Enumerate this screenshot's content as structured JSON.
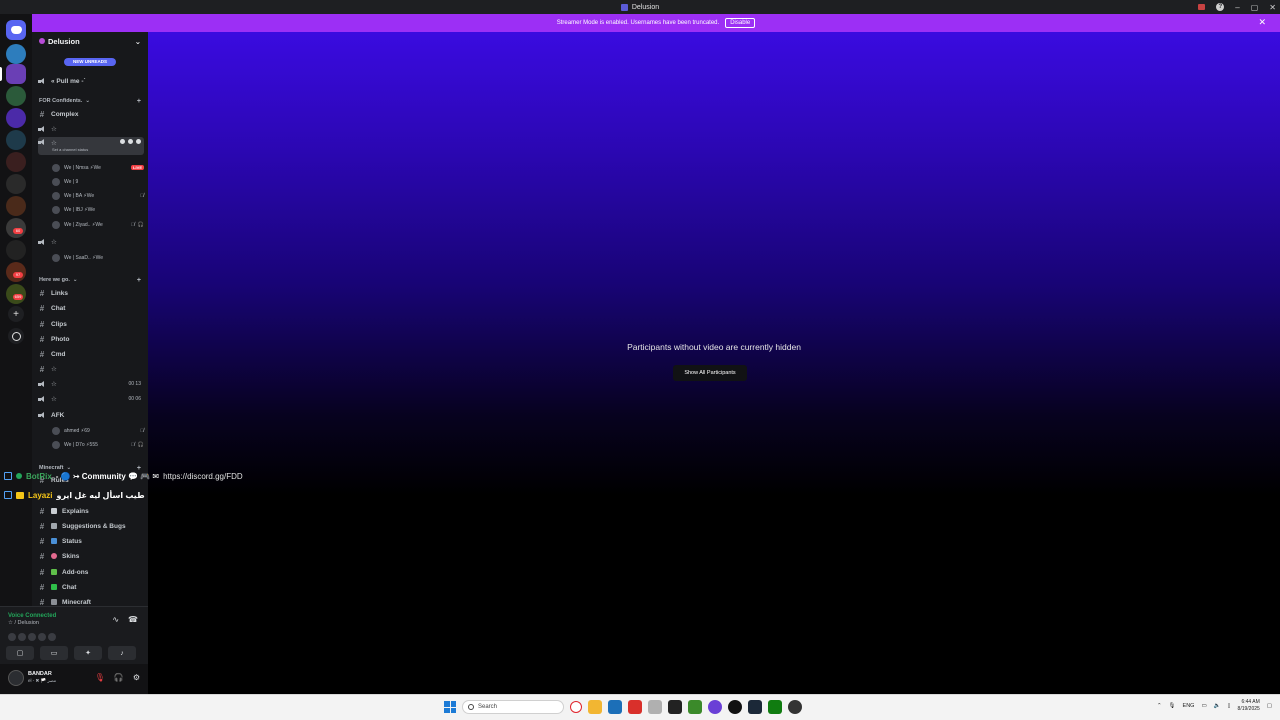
{
  "window": {
    "title": "Delusion"
  },
  "banner": {
    "text": "Streamer Mode is enabled. Usernames have been truncated.",
    "disable_label": "Disable"
  },
  "guild": {
    "name": "Delusion",
    "new_unreads": "NEW UNREADS"
  },
  "channels": {
    "pull_me": "« Pull me -ˊ",
    "cat_confidents": "FOR Confidents.",
    "complex": "Complex",
    "voice_1": "☆",
    "voice_sel": "☆",
    "set_status": "Set a channel status",
    "voice_3": "☆",
    "cat_here": "Here we go.",
    "links": "Links",
    "chat": "Chat",
    "clips": "Clips",
    "photo": "Photo",
    "cmd": "Cmd",
    "voice_4": "☆",
    "voice_5": "☆",
    "voice_5_count": "00 13",
    "voice_6": "☆",
    "voice_6_count": "00 06",
    "afk": "AFK",
    "cat_minecraft": "Minecraft",
    "rules": "Rules",
    "explains": "Explains",
    "suggestions": "Suggestions & Bugs",
    "status": "Status",
    "skins": "Skins",
    "addons": "Add-ons",
    "mc_chat": "Chat",
    "minecraft": "Minecraft"
  },
  "voice_users": [
    {
      "name": "We | Nmsa ⚡We",
      "tag": "LIVE"
    },
    {
      "name": "We | 9"
    },
    {
      "name": "We | BA ⚡We"
    },
    {
      "name": "We | IBJ ⚡We"
    },
    {
      "name": "We | Ziyad.. ⚡We"
    },
    {
      "name": "We | SaaD.. ⚡We"
    }
  ],
  "afk_users": [
    {
      "name": "ahmed ⚡69"
    },
    {
      "name": "We | D7o ⚡555"
    }
  ],
  "voice_panel": {
    "title": "Voice Connected",
    "sub": "☆ / Delusion"
  },
  "user_panel": {
    "name": "BANDAR",
    "status": "el - ✖ 🏳️ مصر"
  },
  "stage": {
    "message": "Participants without video are currently hidden",
    "show_all": "Show All Participants"
  },
  "overlay": [
    {
      "name": "BotRix",
      "text": "- 🔵 ↣ Community 💬 🎮 ✉",
      "link": "https://discord.gg/FDD"
    },
    {
      "name": "Layazi",
      "text": "طيب اسأل ليه غل ايرو"
    }
  ],
  "taskbar": {
    "search": "Search",
    "lang": "ENG",
    "time": "6:44 AM",
    "date": "8/19/2025"
  },
  "colors": {
    "banner": "#9c2ff5",
    "blurple": "#5865f2",
    "voice_green": "#23a55a",
    "live_red": "#f23f43"
  }
}
